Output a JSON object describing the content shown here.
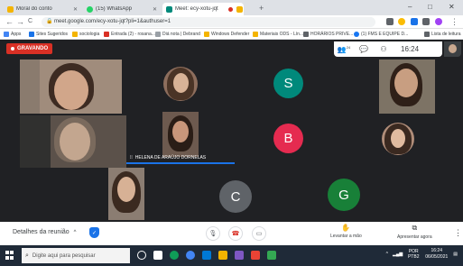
{
  "browser": {
    "tabs": [
      {
        "title": "Moral do conto",
        "color": "#f4b400",
        "active": false
      },
      {
        "title": "(15) WhatsApp",
        "color": "#25d366",
        "active": false
      },
      {
        "title": "Meet: ecy-xotu-jqt",
        "color": "#00897b",
        "active": true
      },
      {
        "title": "",
        "color": "#f4b400",
        "active": false
      }
    ],
    "new_tab": "+",
    "window_controls": {
      "minimize": "–",
      "maximize": "□",
      "close": "✕"
    },
    "nav": {
      "back": "←",
      "forward": "→",
      "reload": "C",
      "home": "⌂"
    },
    "url": "meet.google.com/ecy-xotu-jqt?pli=1&authuser=1",
    "bookmarks": [
      {
        "label": "Apps",
        "color": "#4285f4"
      },
      {
        "label": "Sites Sugeridos",
        "color": "#1a73e8"
      },
      {
        "label": "sociologia",
        "color": "#f4b400"
      },
      {
        "label": "Entrada (2) - rosana...",
        "color": "#d93025"
      },
      {
        "label": "Diá nota | Debrand",
        "color": "#9aa0a6"
      },
      {
        "label": "Diá nota | Debrand",
        "color": "#9aa0a6"
      },
      {
        "label": "Windows Defender",
        "color": "#f4b400"
      },
      {
        "label": "Materiais ODS - Lín...",
        "color": "#f4b400"
      },
      {
        "label": "HORÁRIOS PRIVE...",
        "color": "#5f6368"
      },
      {
        "label": "(1) FMS E EQUIPE D...",
        "color": "#1877f2"
      },
      {
        "label": "Lista de leitura",
        "color": "#5f6368"
      }
    ]
  },
  "meet": {
    "recording_label": "GRAVANDO",
    "clock": "16:24",
    "top_panel": {
      "people_count": "24",
      "chat_icon": "chat-icon",
      "activities_icon": "activities-icon"
    },
    "speaker_name": "HELENA DE ARAÚJO DORNELAS",
    "avatars": [
      {
        "letter": "S",
        "color": "#00897b"
      },
      {
        "letter": "B",
        "color": "#e52b50"
      },
      {
        "letter": "C",
        "color": "#5f6368"
      },
      {
        "letter": "G",
        "color": "#188038"
      }
    ],
    "bottom": {
      "details_label": "Detalhes da reunião",
      "chevron": "^",
      "raise_hand_label": "Levantar a mão",
      "present_label": "Apresentar agora",
      "more": "⋮"
    }
  },
  "taskbar": {
    "search_placeholder": "Digite aqui para pesquisar",
    "tray_lang": "POR PTB2",
    "time": "16:24",
    "date": "06/05/2021",
    "apps": [
      {
        "name": "task-view",
        "color": "#ffffff"
      },
      {
        "name": "file-explorer",
        "color": "#f4b400"
      },
      {
        "name": "edge",
        "color": "#0f9d58"
      },
      {
        "name": "chrome",
        "color": "#4285f4"
      },
      {
        "name": "store",
        "color": "#0078d4"
      },
      {
        "name": "mail",
        "color": "#2b88d8"
      },
      {
        "name": "photos",
        "color": "#7e57c2"
      },
      {
        "name": "app-yellow",
        "color": "#f4b400"
      },
      {
        "name": "app-green",
        "color": "#34a853"
      },
      {
        "name": "app-red",
        "color": "#ea4335"
      }
    ]
  }
}
